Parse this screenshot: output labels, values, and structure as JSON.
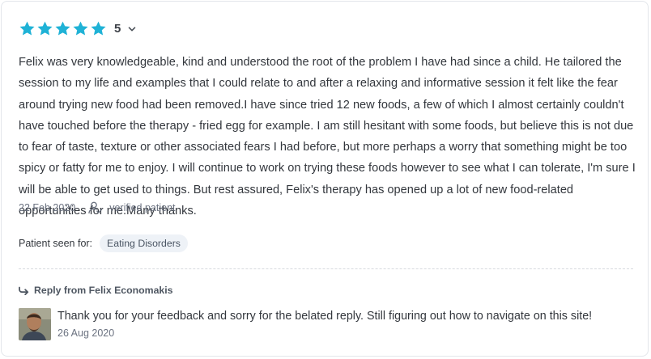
{
  "review": {
    "rating": {
      "stars_filled": 5,
      "stars_total": 5,
      "value_label": "5",
      "star_color": "#1fb2d6",
      "dropdown_icon": "chevron-down-icon"
    },
    "text": "Felix was very knowledgeable, kind and understood the root of the problem I have had since a child. He tailored the session to my life and examples that I could relate to and after a relaxing and informative session it felt like the fear around trying new food had been removed.I have since tried 12 new foods, a few of which I almost certainly couldn't have touched before the therapy - fried egg for example. I am still hesitant with some foods, but believe this is not due to fear of taste, texture or other associated fears I had before, but more perhaps a worry that something might be too spicy or fatty for me to enjoy. I will continue to work on trying these foods however to see what I can tolerate, I'm sure I will be able to get used to things. But rest assured, Felix's therapy has opened up a lot of new food-related opportunities for me.Many thanks.",
    "date": "22 Feb 2020",
    "verified_label": "verified patient",
    "verified_icon": "verified-user-icon",
    "seen_for_label": "Patient seen for:",
    "tags": [
      "Eating Disorders"
    ]
  },
  "reply": {
    "heading": "Reply from Felix Economakis",
    "heading_icon": "reply-arrow-icon",
    "text": "Thank you for your feedback and sorry for the belated reply. Still figuring out how to navigate on this site!",
    "date": "26 Aug 2020"
  }
}
